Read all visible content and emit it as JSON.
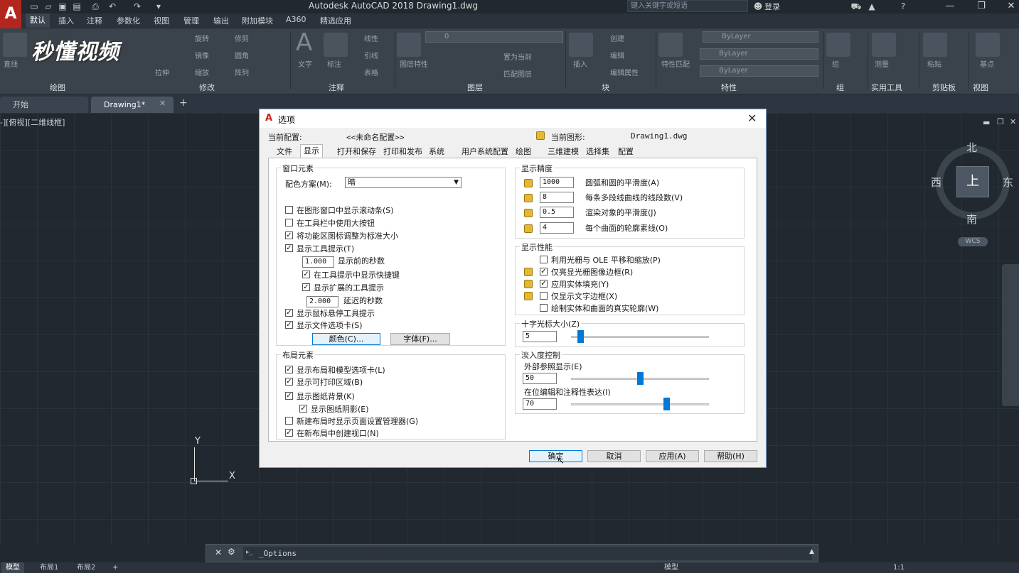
{
  "app": {
    "title": "Autodesk AutoCAD 2018    Drawing1.dwg",
    "search_placeholder": "键入关键字或短语",
    "login": "登录",
    "logo": "A"
  },
  "watermark": "秒懂视频",
  "ribbon_tabs": [
    "默认",
    "插入",
    "注释",
    "参数化",
    "视图",
    "管理",
    "输出",
    "附加模块",
    "A360",
    "精选应用"
  ],
  "ribbon_panels": [
    "绘图",
    "修改",
    "注释",
    "图层",
    "块",
    "特性",
    "组",
    "实用工具",
    "剪贴板",
    "视图"
  ],
  "ribbon_labels": {
    "text": "文字",
    "dim": "标注",
    "layer_prop": "图层特性",
    "insert": "插入",
    "match": "特性匹配",
    "layer_value": "0",
    "bylayer1": "ByLayer",
    "bylayer2": "ByLayer",
    "bylayer3": "ByLayer",
    "line": "直线",
    "rotate": "旋转",
    "mirror": "镜像",
    "stretch": "拉伸",
    "scale": "缩放",
    "array": "阵列",
    "fillet": "圆角",
    "trim": "修剪",
    "linear": "线性",
    "leader": "引线",
    "table": "表格",
    "create": "创建",
    "edit": "编辑",
    "edit_attr": "编辑属性",
    "make_current": "置为当前",
    "match_layer": "匹配图层",
    "group": "组",
    "measure": "测量",
    "paste": "粘贴",
    "base": "基点"
  },
  "doc_tabs": [
    "开始",
    "Drawing1*"
  ],
  "view_label": "-][俯视][二维线框]",
  "viewcube": {
    "top": "上",
    "north": "北",
    "south": "南",
    "east": "东",
    "west": "西",
    "wcs": "WCS"
  },
  "ucs": {
    "x": "X",
    "y": "Y"
  },
  "command_line": "_Options",
  "status_tabs": [
    "模型",
    "布局1",
    "布局2"
  ],
  "status_right": {
    "model": "模型",
    "scale": "1:1"
  },
  "dialog": {
    "title": "选项",
    "current_profile_label": "当前配置:",
    "current_profile_value": "<<未命名配置>>",
    "current_drawing_label": "当前图形:",
    "current_drawing_value": "Drawing1.dwg",
    "tabs": [
      "文件",
      "显示",
      "打开和保存",
      "打印和发布",
      "系统",
      "用户系统配置",
      "绘图",
      "三维建模",
      "选择集",
      "配置"
    ],
    "window_elements": {
      "title": "窗口元素",
      "color_scheme_label": "配色方案(M):",
      "color_scheme_value": "暗",
      "options": [
        {
          "label": "在图形窗口中显示滚动条(S)",
          "checked": false
        },
        {
          "label": "在工具栏中使用大按钮",
          "checked": false
        },
        {
          "label": "将功能区图标调整为标准大小",
          "checked": true
        },
        {
          "label": "显示工具提示(T)",
          "checked": true
        }
      ],
      "seconds_before": "1.000",
      "seconds_before_label": "显示前的秒数",
      "show_shortcut": {
        "label": "在工具提示中显示快捷键",
        "checked": true
      },
      "show_extended": {
        "label": "显示扩展的工具提示",
        "checked": true
      },
      "delay_value": "2.000",
      "delay_label": "延迟的秒数",
      "rollover": {
        "label": "显示鼠标悬停工具提示",
        "checked": true
      },
      "file_tabs": {
        "label": "显示文件选项卡(S)",
        "checked": true
      },
      "colors_button": "颜色(C)...",
      "fonts_button": "字体(F)..."
    },
    "layout_elements": {
      "title": "布局元素",
      "options": [
        {
          "label": "显示布局和模型选项卡(L)",
          "checked": true
        },
        {
          "label": "显示可打印区域(B)",
          "checked": true
        },
        {
          "label": "显示图纸背景(K)",
          "checked": true
        },
        {
          "label": "显示图纸阴影(E)",
          "checked": true
        },
        {
          "label": "新建布局时显示页面设置管理器(G)",
          "checked": false
        },
        {
          "label": "在新布局中创建视口(N)",
          "checked": true
        }
      ]
    },
    "display_resolution": {
      "title": "显示精度",
      "items": [
        {
          "value": "1000",
          "label": "圆弧和圆的平滑度(A)"
        },
        {
          "value": "8",
          "label": "每条多段线曲线的线段数(V)"
        },
        {
          "value": "0.5",
          "label": "渲染对象的平滑度(J)"
        },
        {
          "value": "4",
          "label": "每个曲面的轮廓素线(O)"
        }
      ]
    },
    "display_performance": {
      "title": "显示性能",
      "options": [
        {
          "label": "利用光栅与 OLE 平移和缩放(P)",
          "checked": false
        },
        {
          "label": "仅亮显光栅图像边框(R)",
          "checked": true
        },
        {
          "label": "应用实体填充(Y)",
          "checked": true
        },
        {
          "label": "仅显示文字边框(X)",
          "checked": false
        },
        {
          "label": "绘制实体和曲面的真实轮廓(W)",
          "checked": false
        }
      ]
    },
    "crosshair": {
      "title": "十字光标大小(Z)",
      "value": "5",
      "level_pct": 5
    },
    "fade": {
      "title": "淡入度控制",
      "xref_label": "外部参照显示(E)",
      "xref_value": "50",
      "xref_level_pct": 50,
      "inplace_label": "在位编辑和注释性表达(I)",
      "inplace_value": "70",
      "inplace_level_pct": 70
    },
    "buttons": {
      "ok": "确定",
      "cancel": "取消",
      "apply": "应用(A)",
      "help": "帮助(H)"
    }
  }
}
